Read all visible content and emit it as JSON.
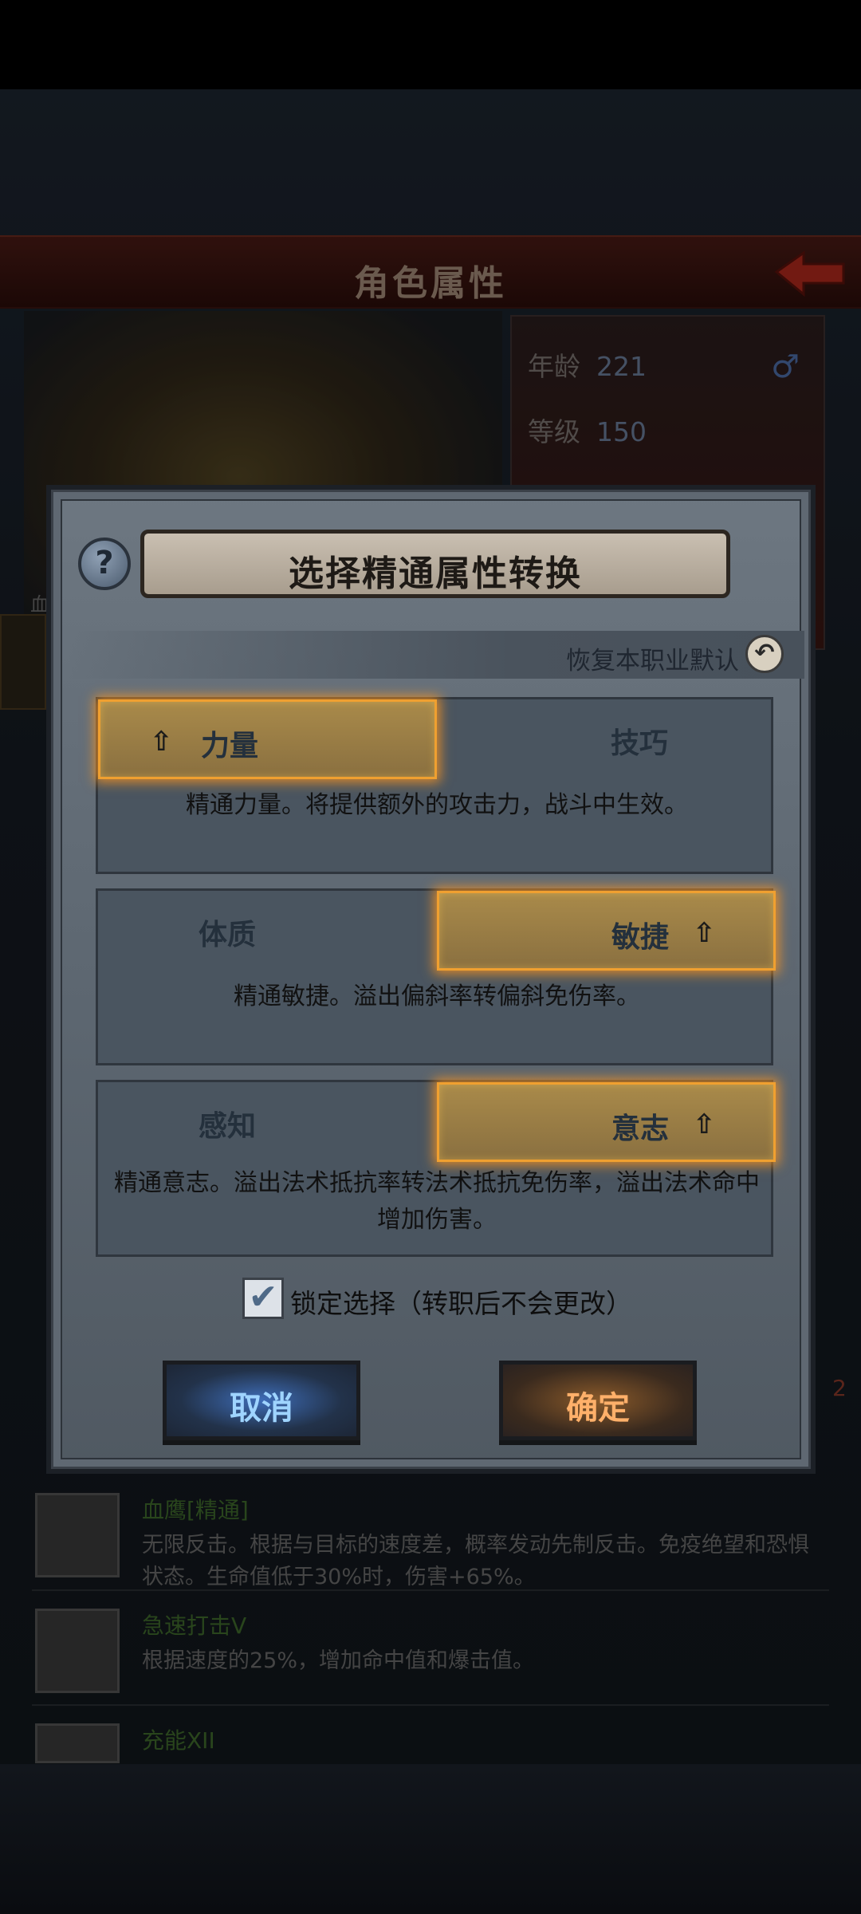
{
  "background": {
    "header_title": "角色属性",
    "age_label": "年龄",
    "age_value": "221",
    "level_label": "等级",
    "level_value": "150",
    "left_tag": "血",
    "side_number": "2"
  },
  "dialog": {
    "title": "选择精通属性转换",
    "help_glyph": "?",
    "reset_label": "恢复本职业默认",
    "attributes": [
      {
        "left": "力量",
        "right": "技巧",
        "selected": "left",
        "desc": "精通力量。将提供额外的攻击力，战斗中生效。"
      },
      {
        "left": "体质",
        "right": "敏捷",
        "selected": "right",
        "desc": "精通敏捷。溢出偏斜率转偏斜免伤率。"
      },
      {
        "left": "感知",
        "right": "意志",
        "selected": "right",
        "desc_line1": "精通意志。溢出法术抵抗率转法术抵抗免伤率，溢出法术命中",
        "desc_line2": "增加伤害。"
      }
    ],
    "lock_label": "锁定选择（转职后不会更改）",
    "lock_checked": true,
    "cancel_label": "取消",
    "confirm_label": "确定"
  },
  "skills": [
    {
      "name": "血鹰[精通]",
      "desc_line1": "无限反击。根据与目标的速度差，概率发动先制反击。免疫绝望和恐惧",
      "desc_line2": "状态。生命值低于30%时，伤害+65%。"
    },
    {
      "name": "急速打击V",
      "desc_line1": "根据速度的25%，增加命中值和爆击值。"
    },
    {
      "name": "充能XII"
    }
  ],
  "colors": {
    "selected_glow": "#f0a030",
    "skill_name": "#3f6b2c",
    "cancel_text": "#9fd4ff",
    "confirm_text": "#ffb06a"
  }
}
